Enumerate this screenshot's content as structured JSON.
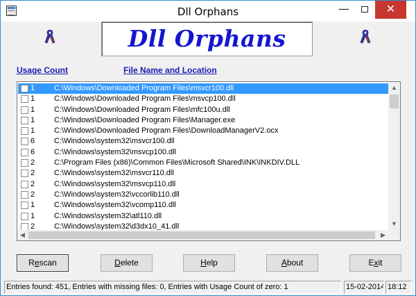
{
  "window": {
    "title": "Dll Orphans"
  },
  "titlebar_controls": {
    "minimize": "—",
    "close": "✕"
  },
  "banner": {
    "text": "Dll Orphans"
  },
  "columns": {
    "count": "Usage Count",
    "file": "File Name and Location"
  },
  "rows": [
    {
      "count": "1",
      "path": "C:\\Windows\\Downloaded Program Files\\msvcr100.dll",
      "selected": true
    },
    {
      "count": "1",
      "path": "C:\\Windows\\Downloaded Program Files\\msvcp100.dll"
    },
    {
      "count": "1",
      "path": "C:\\Windows\\Downloaded Program Files\\mfc100u.dll"
    },
    {
      "count": "1",
      "path": "C:\\Windows\\Downloaded Program Files\\Manager.exe"
    },
    {
      "count": "1",
      "path": "C:\\Windows\\Downloaded Program Files\\DownloadManagerV2.ocx"
    },
    {
      "count": "6",
      "path": "C:\\Windows\\system32\\msvcr100.dll"
    },
    {
      "count": "6",
      "path": "C:\\Windows\\system32\\msvcp100.dll"
    },
    {
      "count": "2",
      "path": "C:\\Program Files (x86)\\Common Files\\Microsoft Shared\\INK\\INKDIV.DLL"
    },
    {
      "count": "2",
      "path": "C:\\Windows\\system32\\msvcr110.dll"
    },
    {
      "count": "2",
      "path": "C:\\Windows\\system32\\msvcp110.dll"
    },
    {
      "count": "2",
      "path": "C:\\Windows\\system32\\vccorlib110.dll"
    },
    {
      "count": "1",
      "path": "C:\\Windows\\system32\\vcomp110.dll"
    },
    {
      "count": "1",
      "path": "C:\\Windows\\system32\\atl110.dll"
    },
    {
      "count": "2",
      "path": "C:\\Windows\\system32\\d3dx10_41.dll"
    }
  ],
  "buttons": {
    "rescan": {
      "pre": "R",
      "u": "e",
      "post": "scan"
    },
    "delete": {
      "pre": "",
      "u": "D",
      "post": "elete"
    },
    "help": {
      "pre": "",
      "u": "H",
      "post": "elp"
    },
    "about": {
      "pre": "",
      "u": "A",
      "post": "bout"
    },
    "exit": {
      "pre": "E",
      "u": "x",
      "post": "it"
    }
  },
  "status": {
    "main": "Entries found: 451,  Entries with missing files: 0,  Entries with Usage Count of zero: 1",
    "date": "15-02-2014",
    "time": "18:12"
  },
  "colors": {
    "accent": "#1515d0",
    "selection": "#3399ff",
    "close": "#c7372f",
    "header": "#1a1ab0"
  },
  "icons": {
    "app": "app-icon",
    "ribbon": "awareness-ribbon-icon"
  }
}
